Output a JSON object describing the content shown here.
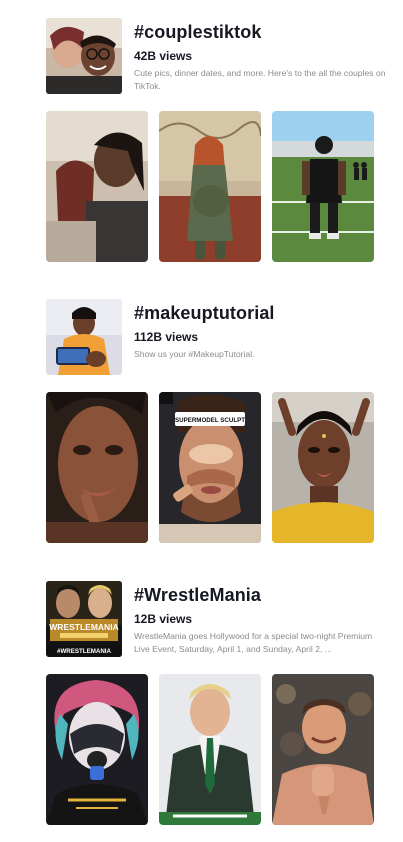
{
  "sections": [
    {
      "title": "#couplestiktok",
      "views": "42B views",
      "description": "Cute pics, dinner dates, and more. Here's to the all the couples on TikTok.",
      "thumbnail": "couple-selfie-image",
      "videos": [
        {
          "image": "couple-leaning-image"
        },
        {
          "image": "pregnant-woman-image"
        },
        {
          "image": "football-player-image"
        }
      ]
    },
    {
      "title": "#makeuptutorial",
      "views": "112B views",
      "description": "Show us your #MakeupTutorial.",
      "thumbnail": "makeup-creator-image",
      "videos": [
        {
          "image": "lip-application-image"
        },
        {
          "image": "contour-sculpt-image",
          "caption": "SUPERMODEL SCULPT"
        },
        {
          "image": "glam-portrait-image"
        }
      ]
    },
    {
      "title": "#WrestleMania",
      "views": "12B views",
      "description": "WrestleMania goes Hollywood for a special two-night Premium Live Event, Saturday, April 1, and Sunday, April 2, ...",
      "thumbnail": "wrestlemania-poster-image",
      "thumbnail_text": "WRESTLEMANIA",
      "thumbnail_tag": "#WRESTLEMANIA",
      "videos": [
        {
          "image": "face-paint-wrestler-image"
        },
        {
          "image": "suited-wrestler-image"
        },
        {
          "image": "shirtless-wrestler-image"
        }
      ]
    }
  ]
}
